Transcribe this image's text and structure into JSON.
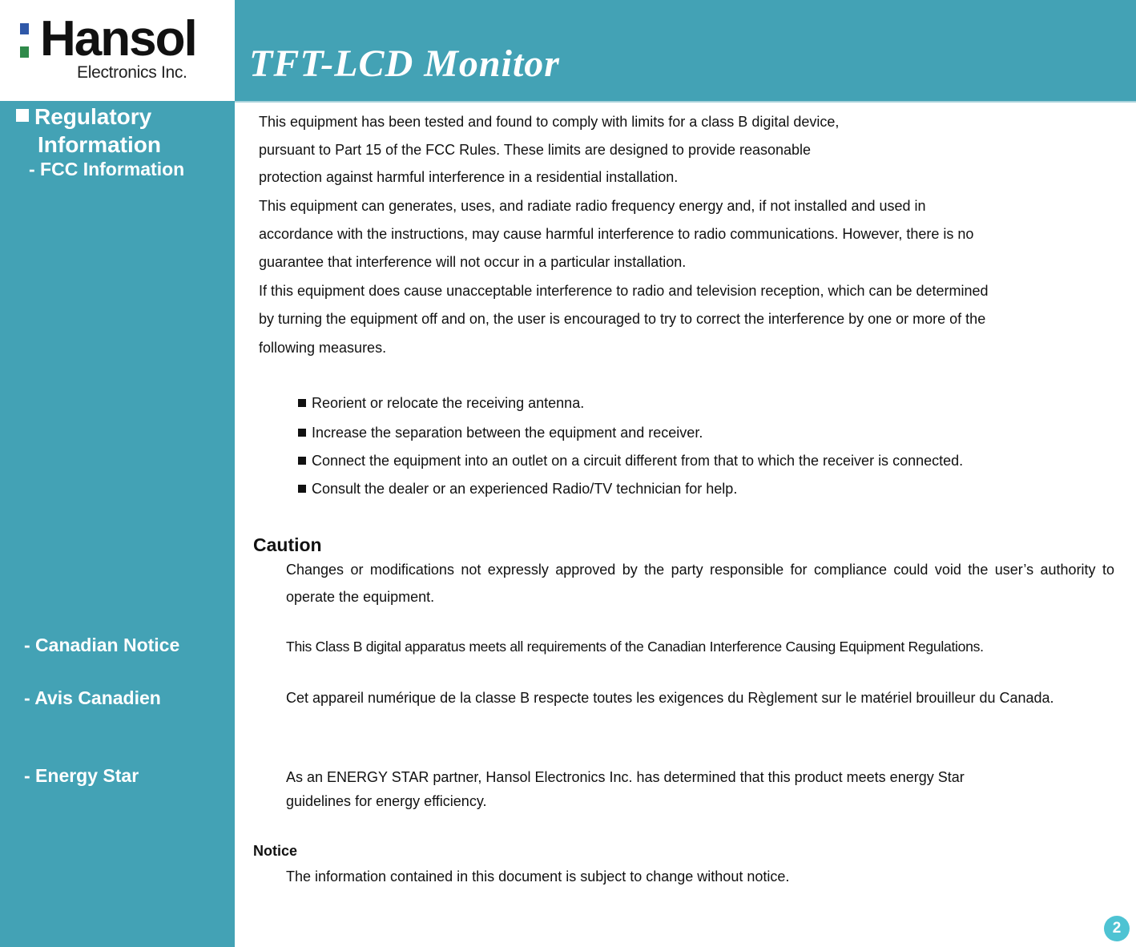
{
  "logo": {
    "wordmark": "Hansol",
    "subtitle": "Electronics Inc.",
    "colors": {
      "top_square": "#2f58a8",
      "bottom_square": "#2f8a4a"
    }
  },
  "header": {
    "title": "TFT-LCD Monitor",
    "background": "#43a2b5"
  },
  "sidebar": {
    "heading_line1": "Regulatory",
    "heading_line2": "Information",
    "items": [
      {
        "label": "- FCC Information"
      },
      {
        "label": "- Canadian Notice"
      },
      {
        "label": "- Avis Canadien"
      },
      {
        "label": "- Energy Star"
      }
    ]
  },
  "fcc": {
    "lines": [
      "This equipment has been tested and found to comply with limits for a class B digital device,",
      "pursuant to Part 15 of the FCC Rules. These limits are designed to provide reasonable",
      "protection against harmful interference in a residential installation.",
      "This equipment can generates, uses, and radiate radio frequency energy and, if not installed and used in",
      "accordance with the instructions, may cause harmful interference to radio communications. However, there is no",
      "guarantee that interference will not occur in a particular installation.",
      "If this equipment does cause unacceptable interference to radio and television reception, which can be determined",
      "by turning the equipment off and on, the user is encouraged to try to correct the interference by one or more of the",
      "following measures."
    ],
    "measures": [
      "Reorient or relocate the receiving antenna.",
      "Increase the separation between the equipment and receiver.",
      "Connect the equipment into an outlet on a circuit different from that to which the receiver is connected.",
      "Consult the dealer or an experienced Radio/TV technician for help."
    ]
  },
  "caution": {
    "heading": "Caution",
    "text": "Changes or modifications not expressly approved by the party responsible for compliance could void the user’s authority to operate the equipment."
  },
  "canadian_notice": {
    "text": "This Class B digital apparatus meets all requirements of the Canadian Interference Causing Equipment Regulations."
  },
  "avis_canadien": {
    "text": "Cet appareil numérique de la classe B respecte toutes les exigences du Règlement sur le matériel brouilleur du Canada."
  },
  "energy_star": {
    "line1": "As an ENERGY STAR partner, Hansol Electronics Inc. has determined that this product meets energy Star",
    "line2": "guidelines for energy efficiency."
  },
  "notice": {
    "heading": "Notice",
    "text": "The information contained in this document is subject to change without notice."
  },
  "page": {
    "number": "2",
    "badge_color": "#4ec3d3"
  }
}
